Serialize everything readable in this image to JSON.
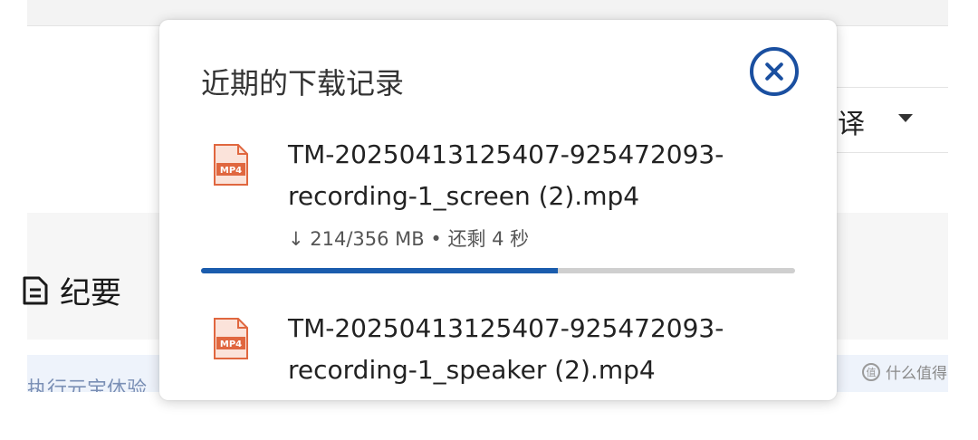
{
  "background": {
    "translate_label": "译",
    "summary_label": "纪要",
    "bottom_text": "执行元宝体验",
    "watermark": "什么值得买",
    "watermark_logo": "值"
  },
  "panel": {
    "title": "近期的下载记录",
    "close_icon": "close-circle-icon",
    "downloads": [
      {
        "icon": "mp4-file-icon",
        "file_type_label": "MP4",
        "name_line1": "TM-20250413125407-925472093-",
        "name_line2": "recording-1_screen (2).mp4",
        "status": "↓ 214/356 MB • 还剩 4 秒",
        "progress": 0.6
      },
      {
        "icon": "mp4-file-icon",
        "file_type_label": "MP4",
        "name_line1": "TM-20250413125407-925472093-",
        "name_line2": "recording-1_speaker (2).mp4"
      }
    ]
  },
  "colors": {
    "accent": "#1a4fa0",
    "progress_fill": "#1a5cad",
    "progress_track": "#cfcfcf",
    "file_icon": "#e0673f"
  }
}
